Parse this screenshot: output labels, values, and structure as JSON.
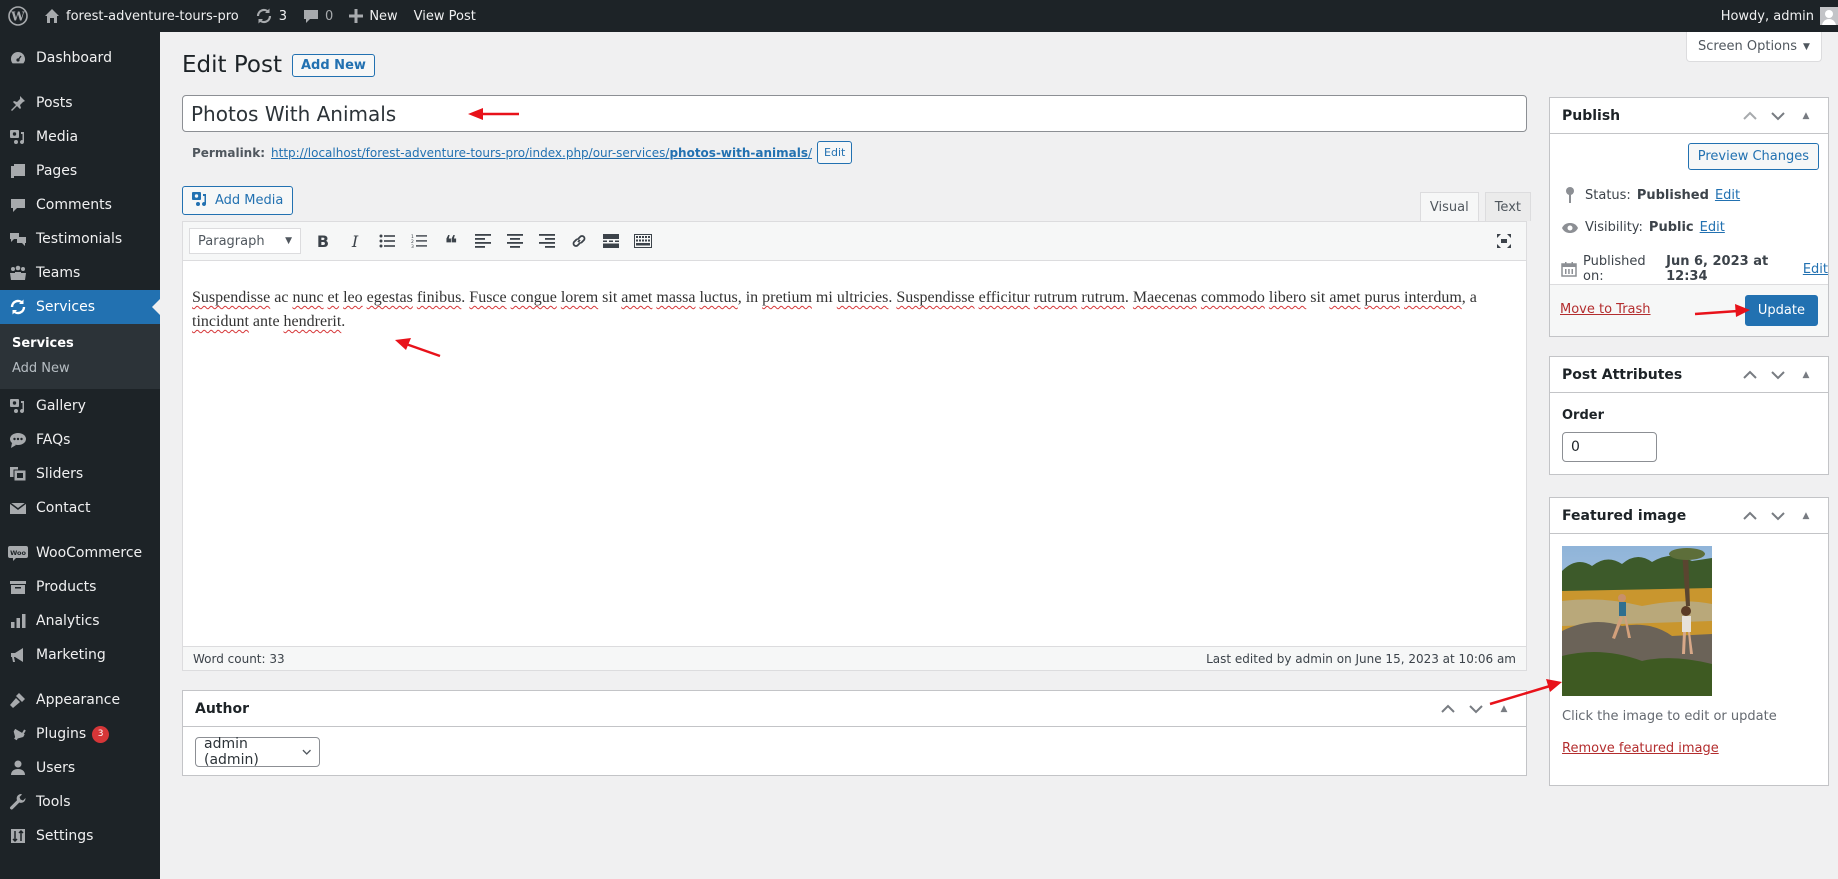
{
  "adminbar": {
    "site_name": "forest-adventure-tours-pro",
    "updates_count": "3",
    "comments_count": "0",
    "new_label": "New",
    "view_post_label": "View Post",
    "howdy": "Howdy, admin"
  },
  "sidebar": {
    "items": [
      {
        "label": "Dashboard",
        "icon": "dashboard-icon"
      },
      {
        "label": "Posts",
        "icon": "pin-icon"
      },
      {
        "label": "Media",
        "icon": "media-icon"
      },
      {
        "label": "Pages",
        "icon": "pages-icon"
      },
      {
        "label": "Comments",
        "icon": "comment-icon"
      },
      {
        "label": "Testimonials",
        "icon": "testimonial-icon"
      },
      {
        "label": "Teams",
        "icon": "groups-icon"
      },
      {
        "label": "Services",
        "icon": "update-icon"
      },
      {
        "label": "Gallery",
        "icon": "media-icon"
      },
      {
        "label": "FAQs",
        "icon": "faq-icon"
      },
      {
        "label": "Sliders",
        "icon": "slides-icon"
      },
      {
        "label": "Contact",
        "icon": "email-icon"
      },
      {
        "label": "WooCommerce",
        "icon": "woo-icon"
      },
      {
        "label": "Products",
        "icon": "archive-icon"
      },
      {
        "label": "Analytics",
        "icon": "bar-chart-icon"
      },
      {
        "label": "Marketing",
        "icon": "megaphone-icon"
      },
      {
        "label": "Appearance",
        "icon": "brush-icon"
      },
      {
        "label": "Plugins",
        "icon": "plugin-icon",
        "badge": "3"
      },
      {
        "label": "Users",
        "icon": "user-icon"
      },
      {
        "label": "Tools",
        "icon": "wrench-icon"
      },
      {
        "label": "Settings",
        "icon": "settings-icon"
      }
    ],
    "submenu": [
      {
        "label": "Services"
      },
      {
        "label": "Add New"
      }
    ]
  },
  "screen_options": "Screen Options",
  "page": {
    "title": "Edit Post",
    "add_new": "Add New"
  },
  "post": {
    "title": "Photos With Animals",
    "permalink_label": "Permalink:",
    "permalink_base": "http://localhost/forest-adventure-tours-pro/index.php/our-services/",
    "permalink_slug": "photos-with-animals",
    "permalink_trail": "/",
    "permalink_edit": "Edit"
  },
  "editor": {
    "add_media": "Add Media",
    "tab_visual": "Visual",
    "tab_text": "Text",
    "format": "Paragraph",
    "content_words": [
      [
        "Suspendisse",
        true
      ],
      [
        "ac",
        false
      ],
      [
        "nunc",
        true
      ],
      [
        "et",
        true
      ],
      [
        "leo",
        true
      ],
      [
        "egestas",
        true
      ],
      [
        "finibus.",
        true
      ],
      [
        "Fusce",
        true
      ],
      [
        "congue",
        true
      ],
      [
        "lorem",
        true
      ],
      [
        "sit",
        false
      ],
      [
        "amet",
        true
      ],
      [
        "massa",
        true
      ],
      [
        "luctus,",
        true
      ],
      [
        "in",
        false
      ],
      [
        "pretium",
        true
      ],
      [
        "mi",
        false
      ],
      [
        "ultricies.",
        true
      ],
      [
        "Suspendisse",
        true
      ],
      [
        "efficitur",
        true
      ],
      [
        "rutrum",
        true
      ],
      [
        "rutrum.",
        true
      ],
      [
        "Maecenas",
        true
      ],
      [
        "commodo",
        true
      ],
      [
        "libero",
        true
      ],
      [
        "sit",
        false
      ],
      [
        "amet",
        true
      ],
      [
        "purus",
        true
      ],
      [
        "interdum,",
        true
      ],
      [
        "a",
        false
      ],
      [
        "tincidunt",
        true
      ],
      [
        "ante",
        false
      ],
      [
        "hendrerit.",
        true
      ]
    ],
    "word_count": "Word count: 33",
    "last_edited": "Last edited by admin on June 15, 2023 at 10:06 am"
  },
  "author_box": {
    "title": "Author",
    "selected": "admin (admin)"
  },
  "publish": {
    "title": "Publish",
    "preview": "Preview Changes",
    "status_label": "Status:",
    "status_value": "Published",
    "visibility_label": "Visibility:",
    "visibility_value": "Public",
    "published_label": "Published on:",
    "published_value": "Jun 6, 2023 at 12:34",
    "edit": "Edit",
    "trash": "Move to Trash",
    "update": "Update"
  },
  "attributes": {
    "title": "Post Attributes",
    "order_label": "Order",
    "order_value": "0"
  },
  "featured": {
    "title": "Featured image",
    "hint": "Click the image to edit or update",
    "remove": "Remove featured image"
  },
  "colors": {
    "accent": "#2271b1",
    "admin_dark": "#1d2327",
    "danger": "#b32d2e",
    "annotation": "#e8121a"
  }
}
